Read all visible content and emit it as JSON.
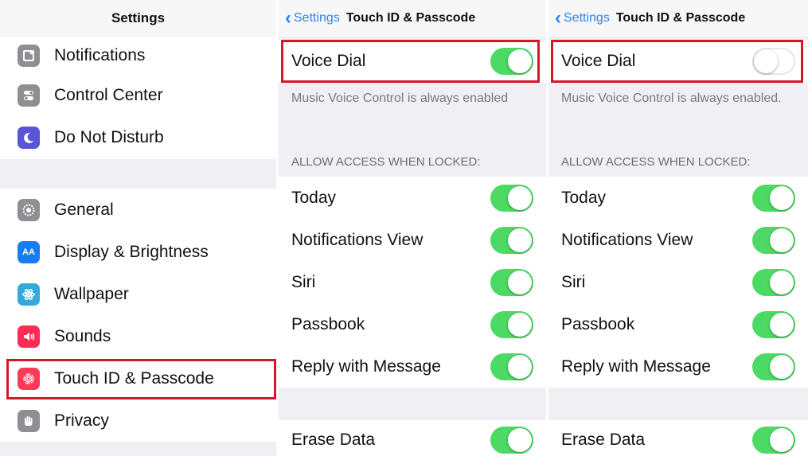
{
  "settings": {
    "title": "Settings",
    "group1": [
      {
        "label": "Notifications",
        "icon": "notifications-icon",
        "color": "#8e8e93"
      },
      {
        "label": "Control Center",
        "icon": "control-center-icon",
        "color": "#8e8e93"
      },
      {
        "label": "Do Not Disturb",
        "icon": "moon-icon",
        "color": "#5856d6"
      }
    ],
    "group2": [
      {
        "label": "General",
        "icon": "gear-icon",
        "color": "#8e8e93"
      },
      {
        "label": "Display & Brightness",
        "icon": "display-brightness-icon",
        "color": "#1a7cf5",
        "glyph": "AA"
      },
      {
        "label": "Wallpaper",
        "icon": "wallpaper-icon",
        "color": "#34aadc"
      },
      {
        "label": "Sounds",
        "icon": "speaker-icon",
        "color": "#ff2d55"
      },
      {
        "label": "Touch ID & Passcode",
        "icon": "fingerprint-icon",
        "color": "#ff3b58"
      },
      {
        "label": "Privacy",
        "icon": "hand-icon",
        "color": "#8e8e93"
      }
    ]
  },
  "panel_on": {
    "back_label": "Settings",
    "title": "Touch ID & Passcode",
    "voice_dial": {
      "label": "Voice Dial",
      "on": true
    },
    "footnote": "Music Voice Control is always enabled",
    "section_header": "ALLOW ACCESS WHEN LOCKED:",
    "items": [
      {
        "label": "Today",
        "on": true
      },
      {
        "label": "Notifications View",
        "on": true
      },
      {
        "label": "Siri",
        "on": true
      },
      {
        "label": "Passbook",
        "on": true
      },
      {
        "label": "Reply with Message",
        "on": true
      }
    ],
    "erase": {
      "label": "Erase Data",
      "on": true
    }
  },
  "panel_off": {
    "back_label": "Settings",
    "title": "Touch ID & Passcode",
    "voice_dial": {
      "label": "Voice Dial",
      "on": false
    },
    "footnote": "Music Voice Control is always enabled.",
    "section_header": "ALLOW ACCESS WHEN LOCKED:",
    "items": [
      {
        "label": "Today",
        "on": true
      },
      {
        "label": "Notifications View",
        "on": true
      },
      {
        "label": "Siri",
        "on": true
      },
      {
        "label": "Passbook",
        "on": true
      },
      {
        "label": "Reply with Message",
        "on": true
      }
    ],
    "erase": {
      "label": "Erase Data",
      "on": true
    }
  },
  "colors": {
    "accent": "#2d82f0",
    "toggle_on": "#4cd964",
    "highlight": "#d6172a"
  }
}
